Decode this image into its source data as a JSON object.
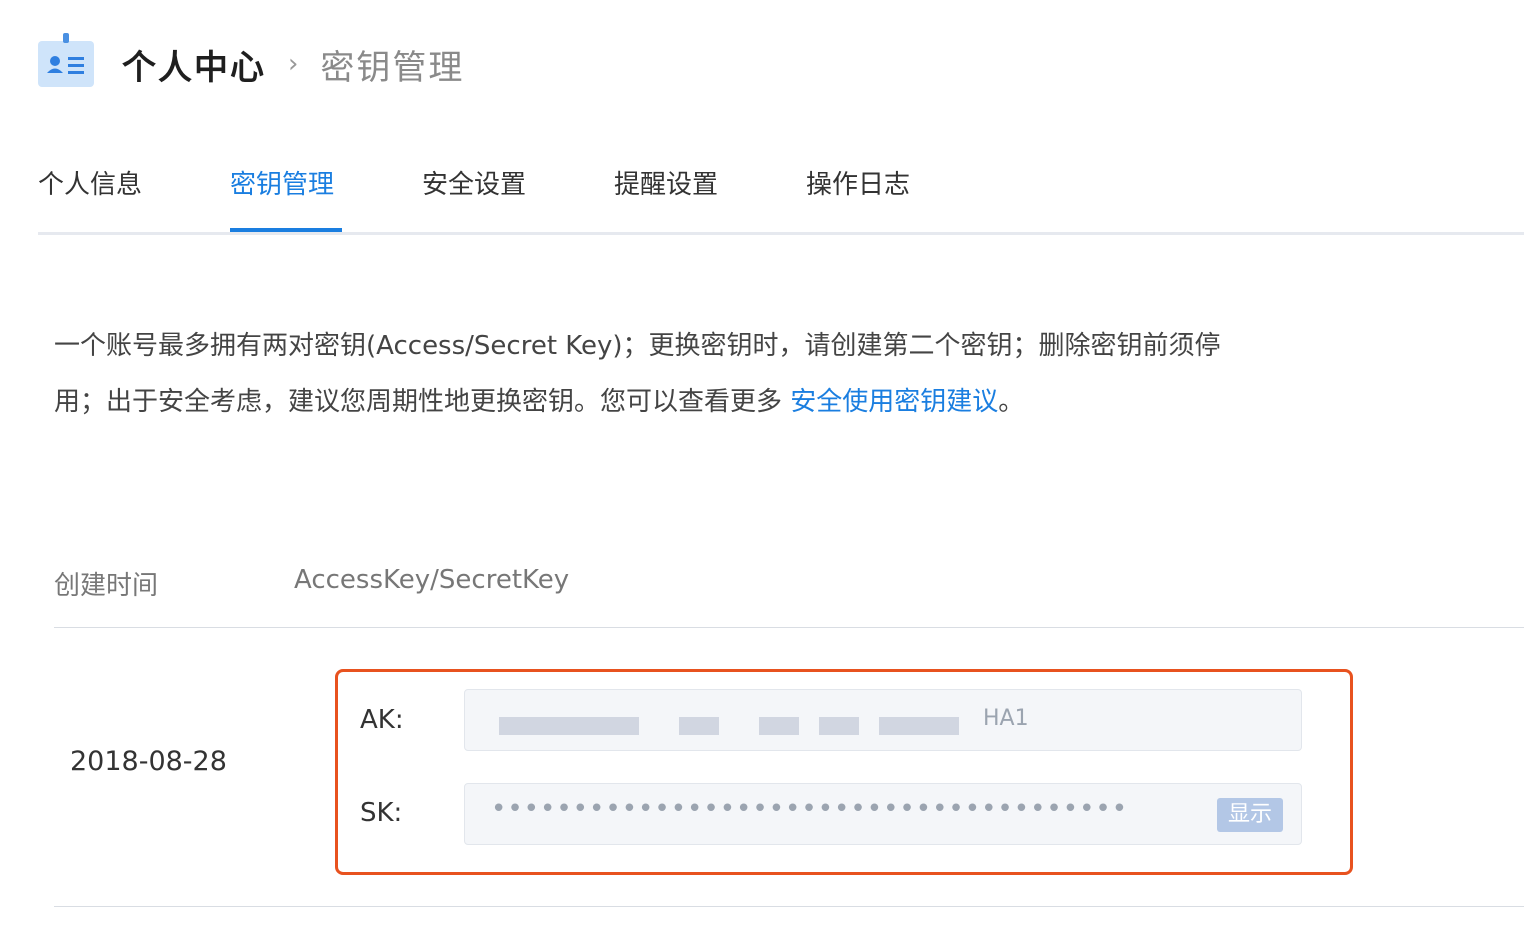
{
  "breadcrumb": {
    "root": "个人中心",
    "separator": "›",
    "current": "密钥管理"
  },
  "tabs": [
    {
      "label": "个人信息"
    },
    {
      "label": "密钥管理",
      "active": true
    },
    {
      "label": "安全设置"
    },
    {
      "label": "提醒设置"
    },
    {
      "label": "操作日志"
    }
  ],
  "description": {
    "line1": "一个账号最多拥有两对密钥(Access/Secret Key)；更换密钥时，请创建第二个密钥；删除密钥前须停",
    "line2_prefix": "用；出于安全考虑，建议您周期性地更换密钥。您可以查看更多 ",
    "link_text": "安全使用密钥建议",
    "line2_suffix": "。"
  },
  "table": {
    "headers": {
      "created": "创建时间",
      "keys": "AccessKey/SecretKey"
    },
    "rows": [
      {
        "created": "2018-08-28",
        "ak_label": "AK:",
        "ak_visible_tail": "HA1",
        "sk_label": "SK:",
        "sk_masked": "•••••••••••••••••••••••••••••••••••••••",
        "show_button": "显示"
      }
    ]
  },
  "colors": {
    "accent": "#1a7ee0",
    "highlight_border": "#e8521f"
  }
}
